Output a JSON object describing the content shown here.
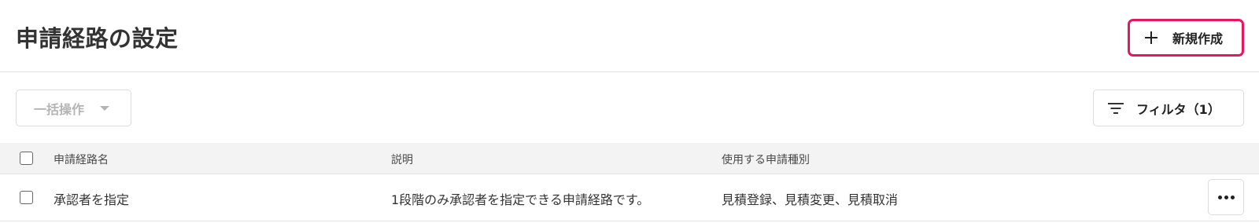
{
  "header": {
    "title": "申請経路の設定",
    "new_button_label": "新規作成",
    "new_button_highlight_color": "#e8155f"
  },
  "toolbar": {
    "bulk_action_label": "一括操作",
    "filter_label": "フィルタ（1）"
  },
  "table": {
    "columns": [
      "申請経路名",
      "説明",
      "使用する申請種別"
    ],
    "rows": [
      {
        "name": "承認者を指定",
        "description": "1段階のみ承認者を指定できる申請経路です。",
        "types": "見積登録、見積変更、見積取消"
      }
    ]
  },
  "icons": {
    "new": "plus-icon",
    "bulk_caret": "caret-down-icon",
    "filter": "filter-icon",
    "row_menu": "more-horizontal-icon"
  }
}
